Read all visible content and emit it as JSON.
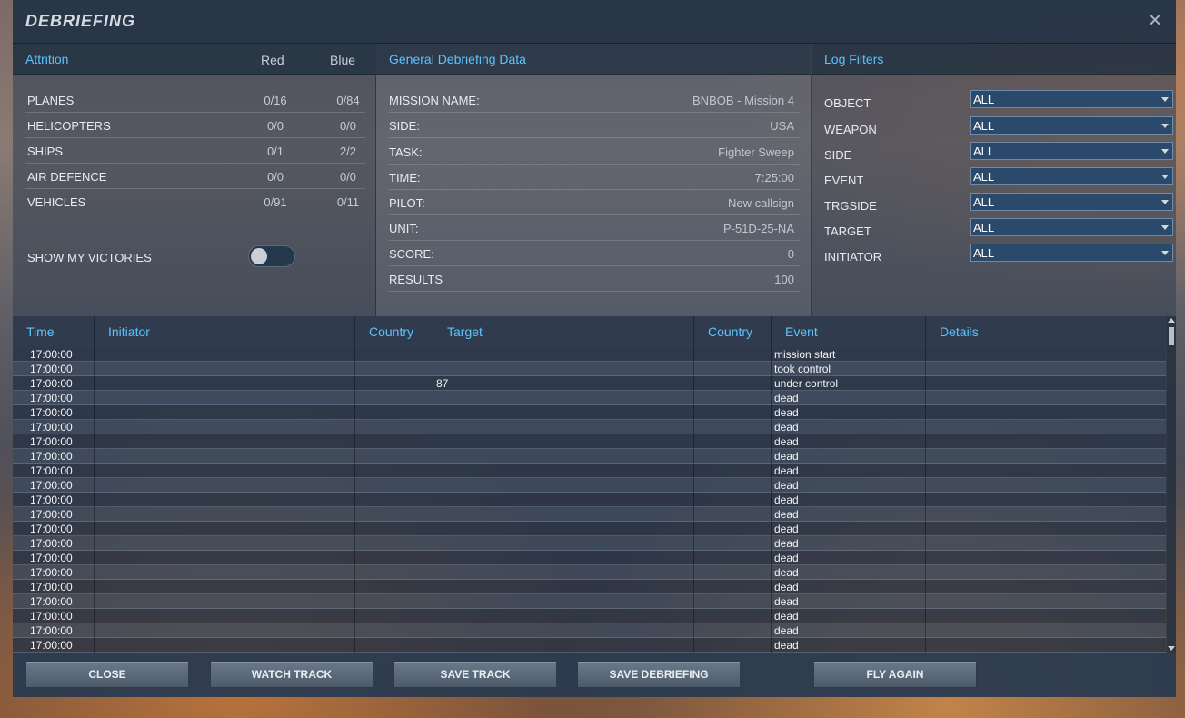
{
  "window": {
    "title": "DEBRIEFING",
    "close_glyph": "✕"
  },
  "attrition": {
    "title": "Attrition",
    "col_red": "Red",
    "col_blue": "Blue",
    "rows": [
      {
        "label": "PLANES",
        "red": "0/16",
        "blue": "0/84"
      },
      {
        "label": "HELICOPTERS",
        "red": "0/0",
        "blue": "0/0"
      },
      {
        "label": "SHIPS",
        "red": "0/1",
        "blue": "2/2"
      },
      {
        "label": "AIR DEFENCE",
        "red": "0/0",
        "blue": "0/0"
      },
      {
        "label": "VEHICLES",
        "red": "0/91",
        "blue": "0/11"
      }
    ],
    "show_victories_label": "SHOW MY VICTORIES",
    "show_victories_on": false
  },
  "general": {
    "title": "General Debriefing Data",
    "rows": [
      {
        "label": "MISSION NAME:",
        "value": "BNBOB - Mission 4"
      },
      {
        "label": "SIDE:",
        "value": "USA"
      },
      {
        "label": "TASK:",
        "value": "Fighter Sweep"
      },
      {
        "label": "TIME:",
        "value": "7:25:00"
      },
      {
        "label": "PILOT:",
        "value": "New callsign"
      },
      {
        "label": "UNIT:",
        "value": "P-51D-25-NA"
      },
      {
        "label": "SCORE:",
        "value": "0"
      },
      {
        "label": "RESULTS",
        "value": "100"
      }
    ]
  },
  "filters": {
    "title": "Log Filters",
    "rows": [
      {
        "label": "OBJECT",
        "value": "ALL"
      },
      {
        "label": "WEAPON",
        "value": "ALL"
      },
      {
        "label": "SIDE",
        "value": "ALL"
      },
      {
        "label": "EVENT",
        "value": "ALL"
      },
      {
        "label": "TRGSIDE",
        "value": "ALL"
      },
      {
        "label": "TARGET",
        "value": "ALL"
      },
      {
        "label": "INITIATOR",
        "value": "ALL"
      }
    ]
  },
  "log": {
    "headers": {
      "time": "Time",
      "initiator": "Initiator",
      "country": "Country",
      "target": "Target",
      "country2": "Country",
      "event": "Event",
      "details": "Details"
    },
    "rows": [
      {
        "time": "17:00:00",
        "target": "",
        "event": "mission start"
      },
      {
        "time": "17:00:00",
        "target": "",
        "event": "took control"
      },
      {
        "time": "17:00:00",
        "target": "87",
        "event": "under control"
      },
      {
        "time": "17:00:00",
        "target": "",
        "event": "dead"
      },
      {
        "time": "17:00:00",
        "target": "",
        "event": "dead"
      },
      {
        "time": "17:00:00",
        "target": "",
        "event": "dead"
      },
      {
        "time": "17:00:00",
        "target": "",
        "event": "dead"
      },
      {
        "time": "17:00:00",
        "target": "",
        "event": "dead"
      },
      {
        "time": "17:00:00",
        "target": "",
        "event": "dead"
      },
      {
        "time": "17:00:00",
        "target": "",
        "event": "dead"
      },
      {
        "time": "17:00:00",
        "target": "",
        "event": "dead"
      },
      {
        "time": "17:00:00",
        "target": "",
        "event": "dead"
      },
      {
        "time": "17:00:00",
        "target": "",
        "event": "dead"
      },
      {
        "time": "17:00:00",
        "target": "",
        "event": "dead"
      },
      {
        "time": "17:00:00",
        "target": "",
        "event": "dead"
      },
      {
        "time": "17:00:00",
        "target": "",
        "event": "dead"
      },
      {
        "time": "17:00:00",
        "target": "",
        "event": "dead"
      },
      {
        "time": "17:00:00",
        "target": "",
        "event": "dead"
      },
      {
        "time": "17:00:00",
        "target": "",
        "event": "dead"
      },
      {
        "time": "17:00:00",
        "target": "",
        "event": "dead"
      },
      {
        "time": "17:00:00",
        "target": "",
        "event": "dead"
      }
    ]
  },
  "buttons": {
    "close": "CLOSE",
    "watch_track": "WATCH TRACK",
    "save_track": "SAVE TRACK",
    "save_debriefing": "SAVE DEBRIEFING",
    "fly_again": "FLY AGAIN"
  },
  "colors": {
    "accent": "#5cc3ff",
    "titlebar": "#233244",
    "button": "#5b6978"
  }
}
